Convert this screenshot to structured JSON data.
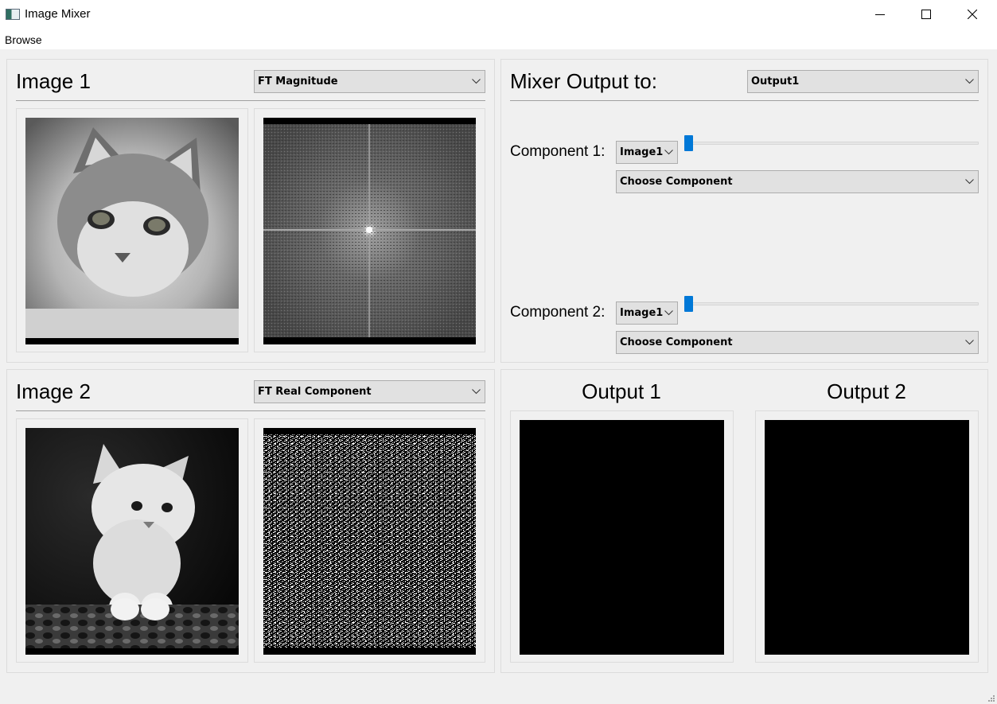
{
  "window": {
    "title": "Image Mixer",
    "icons": {
      "minimize": "minimize-icon",
      "maximize": "maximize-icon",
      "close": "close-icon"
    }
  },
  "menu": {
    "items": [
      "Browse"
    ]
  },
  "image1": {
    "heading": "Image 1",
    "view_select": {
      "value": "FT Magnitude"
    },
    "original_image": "grayscale kitten photo",
    "component_image": "FT magnitude spectrum"
  },
  "image2": {
    "heading": "Image 2",
    "view_select": {
      "value": "FT Real Component"
    },
    "original_image": "grayscale kitten photo",
    "component_image": "FT real component"
  },
  "mixer": {
    "heading": "Mixer Output to:",
    "output_select": {
      "value": "Output1"
    },
    "components": [
      {
        "label": "Component 1:",
        "image_select": "Image1",
        "slider_value": 0,
        "component_select": "Choose Component"
      },
      {
        "label": "Component 2:",
        "image_select": "Image1",
        "slider_value": 0,
        "component_select": "Choose Component"
      }
    ]
  },
  "outputs": [
    {
      "heading": "Output 1"
    },
    {
      "heading": "Output 2"
    }
  ],
  "colors": {
    "accent": "#0078d7",
    "background": "#f0f0f0",
    "image_bg": "#000000"
  }
}
